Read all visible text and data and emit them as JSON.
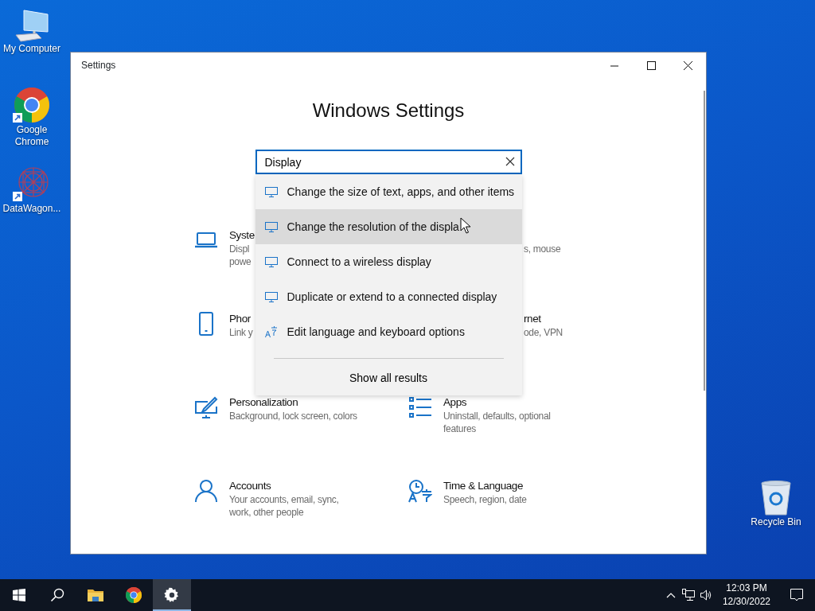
{
  "desktop_icons": [
    {
      "label": "My Computer",
      "kind": "computer"
    },
    {
      "label": "Google Chrome",
      "kind": "chrome"
    },
    {
      "label": "DataWagon...",
      "kind": "datawagon"
    },
    {
      "label": "Recycle Bin",
      "kind": "recycle"
    }
  ],
  "window": {
    "title": "Settings",
    "heading": "Windows Settings",
    "search": {
      "value": "Display"
    },
    "suggestions": [
      {
        "label": "Change the size of text, apps, and other items",
        "kind": "display",
        "selected": false
      },
      {
        "label": "Change the resolution of the displa",
        "kind": "display",
        "selected": true
      },
      {
        "label": "Connect to a wireless display",
        "kind": "display",
        "selected": false
      },
      {
        "label": "Duplicate or extend to a connected display",
        "kind": "display",
        "selected": false
      },
      {
        "label": "Edit language and keyboard options",
        "kind": "language",
        "selected": false
      }
    ],
    "show_all": "Show all results",
    "categories": [
      {
        "kind": "system",
        "title": "Syste",
        "subtitle_lines": [
          "Displ",
          "powe"
        ]
      },
      {
        "subtitle_lines": [
          "s, mouse"
        ]
      },
      {
        "kind": "phone",
        "title": "Phor",
        "subtitle_lines": [
          "Link y"
        ]
      },
      {
        "title": "rnet",
        "subtitle_lines": [
          "ode, VPN"
        ]
      },
      {
        "kind": "personalization",
        "title": "Personalization",
        "subtitle_lines": [
          "Background, lock screen, colors"
        ]
      },
      {
        "kind": "apps",
        "title": "Apps",
        "subtitle_lines": [
          "Uninstall, defaults, optional",
          "features"
        ]
      },
      {
        "kind": "accounts",
        "title": "Accounts",
        "subtitle_lines": [
          "Your accounts, email, sync,",
          "work, other people"
        ]
      },
      {
        "kind": "time",
        "title": "Time & Language",
        "subtitle_lines": [
          "Speech, region, date"
        ]
      }
    ]
  },
  "taskbar": {
    "items": [
      {
        "kind": "start",
        "selected": false
      },
      {
        "kind": "search",
        "selected": false
      },
      {
        "kind": "explorer",
        "selected": false
      },
      {
        "kind": "chrome",
        "selected": false
      },
      {
        "kind": "settings",
        "selected": true
      }
    ],
    "time": "12:03 PM",
    "date": "12/30/2022"
  }
}
